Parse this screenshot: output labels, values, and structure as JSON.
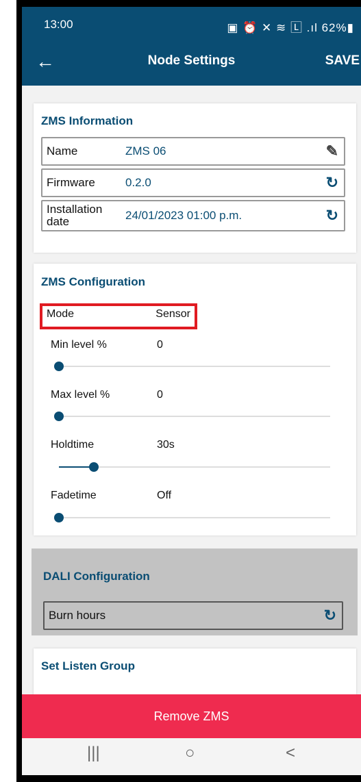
{
  "status_bar": {
    "time": "13:00",
    "icons": "▣ ⏰ ✕ ≋ 🄻 .ıl 62%▮"
  },
  "header": {
    "back_icon": "arrow-left-icon",
    "title": "Node Settings",
    "save_label": "SAVE"
  },
  "info": {
    "title": "ZMS Information",
    "rows": [
      {
        "label": "Name",
        "value": "ZMS 06",
        "icon": "pencil-icon"
      },
      {
        "label": "Firmware",
        "value": "0.2.0",
        "icon": "refresh-icon"
      },
      {
        "label": "Installation date",
        "value": "24/01/2023 01:00 p.m.",
        "icon": "refresh-icon"
      }
    ]
  },
  "config": {
    "title": "ZMS Configuration",
    "mode_label": "Mode",
    "mode_value": "Sensor",
    "sliders": [
      {
        "label": "Min level %",
        "value": "0",
        "fraction": 0.0
      },
      {
        "label": "Max level %",
        "value": "0",
        "fraction": 0.0
      },
      {
        "label": "Holdtime",
        "value": "30s",
        "fraction": 0.13
      },
      {
        "label": "Fadetime",
        "value": "Off",
        "fraction": 0.0
      }
    ]
  },
  "dali": {
    "title": "DALI Configuration",
    "burn_hours_label": "Burn hours"
  },
  "listen_group": {
    "title": "Set Listen Group"
  },
  "remove_label": "Remove ZMS",
  "nav": {
    "recent": "|||",
    "home": "○",
    "back": "<"
  },
  "colors": {
    "primary": "#0a4d73",
    "danger": "#ef2b4f",
    "highlight": "#e01b22"
  }
}
